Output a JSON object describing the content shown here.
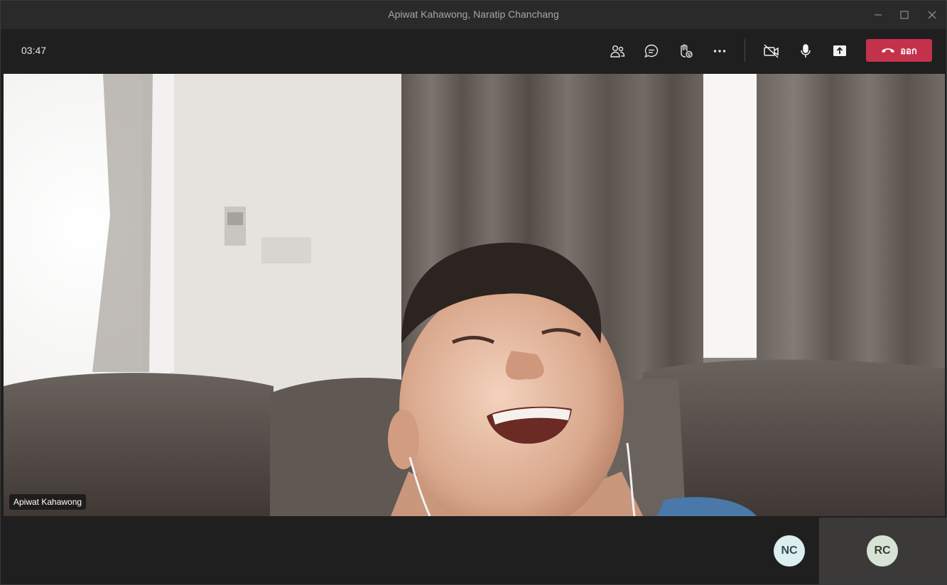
{
  "window": {
    "title": "Apiwat Kahawong, Naratip Chanchang"
  },
  "toolbar": {
    "timer": "03:47",
    "buttons": [
      {
        "name": "participants",
        "icon": "people-icon"
      },
      {
        "name": "chat",
        "icon": "chat-icon"
      },
      {
        "name": "raise-hand",
        "icon": "hand-icon"
      },
      {
        "name": "more",
        "icon": "more-icon"
      },
      {
        "name": "camera",
        "icon": "camera-off-icon"
      },
      {
        "name": "mic",
        "icon": "mic-icon"
      },
      {
        "name": "share",
        "icon": "share-icon"
      }
    ],
    "leave_label": "ออก",
    "leave_color": "#c4314b"
  },
  "video": {
    "speaker_name": "Apiwat Kahawong"
  },
  "participants": [
    {
      "initials": "NC",
      "bg": "#dbeef0",
      "fg": "#2f4f57"
    },
    {
      "initials": "RC",
      "bg": "#d6e3d5",
      "fg": "#34402f"
    }
  ]
}
